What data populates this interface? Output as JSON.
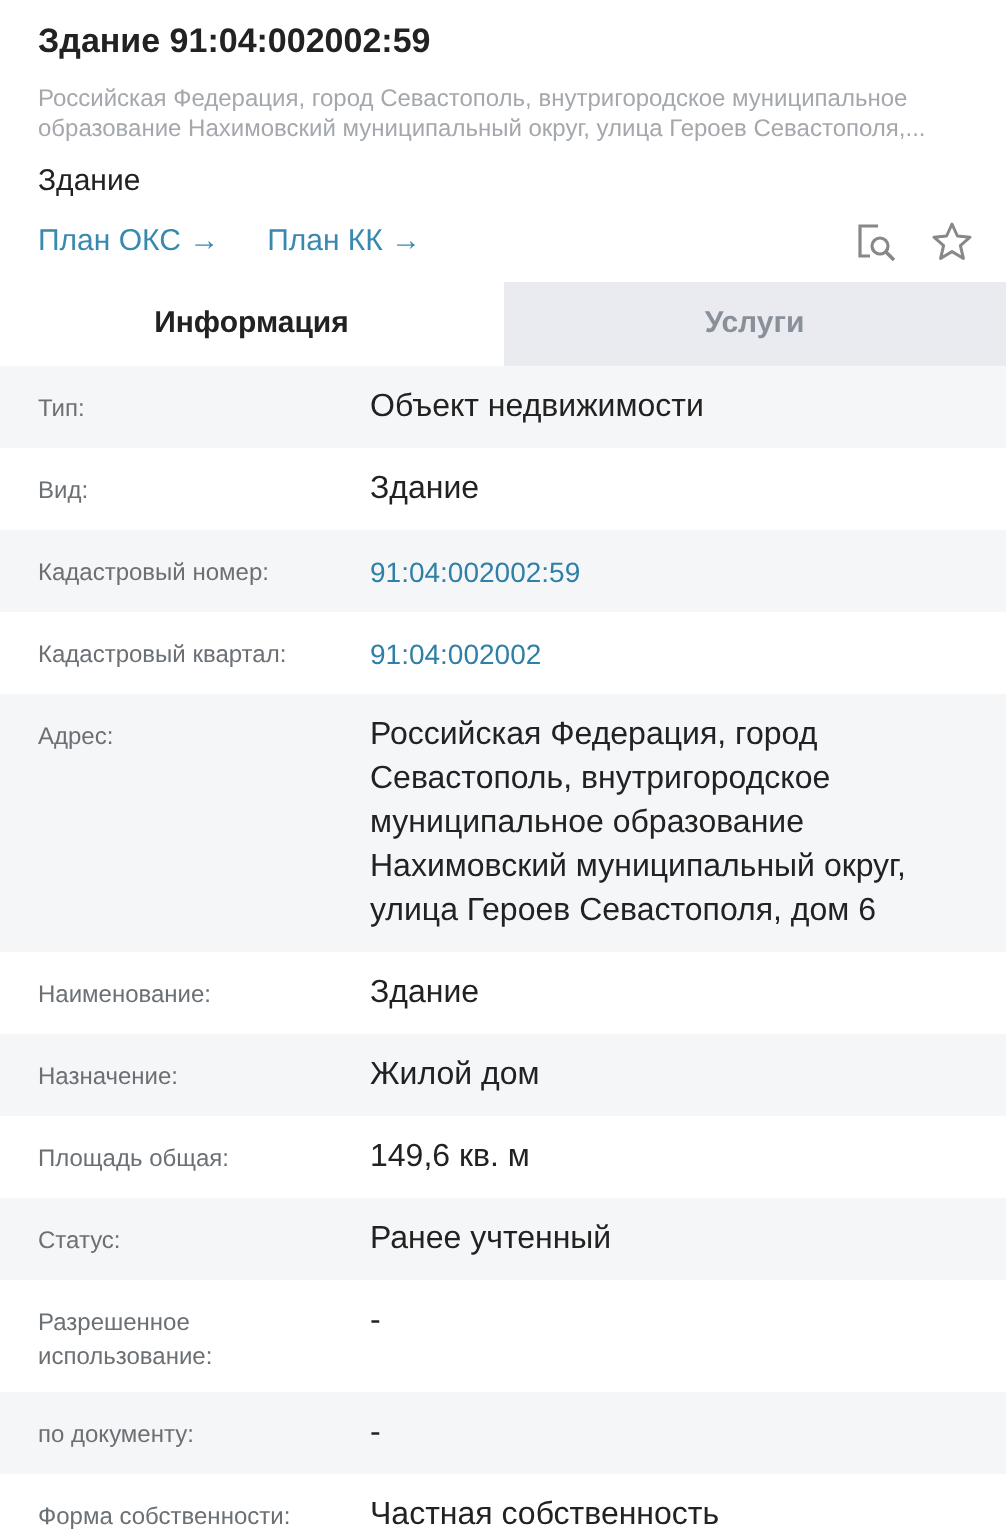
{
  "header": {
    "title": "Здание 91:04:002002:59",
    "address": "Российская Федерация, город Севастополь, внутригородское муниципальное образование Нахимовский муниципальный округ, улица Героев Севастополя,...",
    "object_type": "Здание",
    "links": [
      {
        "label": "План ОКС →"
      },
      {
        "label": "План КК →"
      }
    ]
  },
  "tabs": [
    {
      "label": "Информация",
      "selected": true
    },
    {
      "label": "Услуги",
      "selected": false
    }
  ],
  "fields": [
    {
      "label": "Тип:",
      "value": "Объект недвижимости",
      "kind": "text"
    },
    {
      "label": "Вид:",
      "value": "Здание",
      "kind": "text"
    },
    {
      "label": "Кадастровый номер:",
      "value": "91:04:002002:59",
      "kind": "link"
    },
    {
      "label": "Кадастровый квартал:",
      "value": "91:04:002002",
      "kind": "link"
    },
    {
      "label": "Адрес:",
      "value": "Российская Федерация, город Севастополь, внутригородское муниципальное образование Нахимовский муниципальный округ, улица Героев Севастополя, дом 6",
      "kind": "text"
    },
    {
      "label": "Наименование:",
      "value": "Здание",
      "kind": "text"
    },
    {
      "label": "Назначение:",
      "value": "Жилой дом",
      "kind": "text"
    },
    {
      "label": "Площадь общая:",
      "value": "149,6 кв. м",
      "kind": "text"
    },
    {
      "label": "Статус:",
      "value": "Ранее учтенный",
      "kind": "text"
    },
    {
      "label": "Разрешенное использование:",
      "value": "-",
      "kind": "text"
    },
    {
      "label": "по документу:",
      "value": "-",
      "kind": "text"
    },
    {
      "label": "Форма собственности:",
      "value": "Частная собственность",
      "kind": "text"
    }
  ]
}
